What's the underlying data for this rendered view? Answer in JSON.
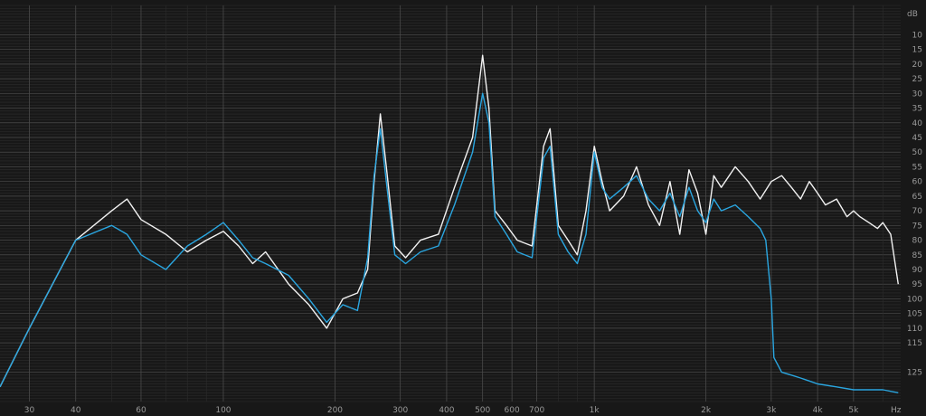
{
  "app": {
    "kind": "spectrum-analyzer"
  },
  "colors": {
    "background": "#151515",
    "plot_background": "#181818",
    "grid_major": "#4a4a4a",
    "grid_minor": "#2c2c2c",
    "tick_text": "#9a9a9a",
    "series_white": "#f2f2f2",
    "series_blue": "#2aa6e0"
  },
  "chart_data": {
    "type": "line",
    "x_scale": "log",
    "xlim": [
      25,
      6700
    ],
    "ylim": [
      0,
      135
    ],
    "y_inverted": true,
    "grid": true,
    "x_ticks": [
      {
        "value": 30,
        "label": "30"
      },
      {
        "value": 40,
        "label": "40"
      },
      {
        "value": 60,
        "label": "60"
      },
      {
        "value": 100,
        "label": "100"
      },
      {
        "value": 200,
        "label": "200"
      },
      {
        "value": 300,
        "label": "300"
      },
      {
        "value": 400,
        "label": "400"
      },
      {
        "value": 500,
        "label": "500"
      },
      {
        "value": 600,
        "label": "600"
      },
      {
        "value": 700,
        "label": "700"
      },
      {
        "value": 1000,
        "label": "1k"
      },
      {
        "value": 2000,
        "label": "2k"
      },
      {
        "value": 3000,
        "label": "3k"
      },
      {
        "value": 4000,
        "label": "4k"
      },
      {
        "value": 5000,
        "label": "5k"
      }
    ],
    "x_unit_label": "Hz",
    "y_ticks": [
      10,
      15,
      20,
      25,
      30,
      35,
      40,
      45,
      50,
      55,
      60,
      65,
      70,
      75,
      80,
      85,
      90,
      95,
      100,
      105,
      110,
      115,
      125
    ],
    "y_unit_label": "dB",
    "series": [
      {
        "key": "white",
        "color": "#f2f2f2",
        "x": [
          25,
          30,
          40,
          50,
          55,
          60,
          70,
          80,
          90,
          100,
          110,
          120,
          130,
          150,
          170,
          190,
          210,
          230,
          245,
          255,
          265,
          275,
          290,
          310,
          340,
          380,
          420,
          470,
          500,
          520,
          540,
          580,
          620,
          680,
          730,
          760,
          800,
          850,
          900,
          950,
          1000,
          1050,
          1100,
          1200,
          1300,
          1400,
          1500,
          1600,
          1700,
          1800,
          1900,
          2000,
          2100,
          2200,
          2400,
          2600,
          2800,
          3000,
          3200,
          3400,
          3600,
          3800,
          4000,
          4200,
          4500,
          4800,
          5000,
          5200,
          5500,
          5800,
          6000,
          6300,
          6600
        ],
        "y": [
          130,
          110,
          80,
          70,
          66,
          73,
          78,
          84,
          80,
          77,
          82,
          88,
          84,
          95,
          102,
          110,
          100,
          98,
          90,
          60,
          37,
          55,
          82,
          86,
          80,
          78,
          62,
          45,
          17,
          35,
          70,
          75,
          80,
          82,
          48,
          42,
          75,
          80,
          85,
          70,
          48,
          60,
          70,
          65,
          55,
          68,
          75,
          60,
          78,
          56,
          64,
          78,
          58,
          62,
          55,
          60,
          66,
          60,
          58,
          62,
          66,
          60,
          64,
          68,
          66,
          72,
          70,
          72,
          74,
          76,
          74,
          78,
          95
        ]
      },
      {
        "key": "blue",
        "color": "#2aa6e0",
        "x": [
          25,
          30,
          40,
          50,
          55,
          60,
          70,
          80,
          90,
          100,
          110,
          120,
          130,
          150,
          170,
          190,
          210,
          230,
          245,
          255,
          265,
          275,
          290,
          310,
          340,
          380,
          420,
          470,
          500,
          520,
          540,
          580,
          620,
          680,
          730,
          760,
          800,
          850,
          900,
          950,
          1000,
          1050,
          1100,
          1200,
          1300,
          1400,
          1500,
          1600,
          1700,
          1800,
          1900,
          2000,
          2100,
          2200,
          2400,
          2600,
          2800,
          2900,
          3000,
          3050,
          3200,
          3400,
          3600,
          3800,
          4000,
          4500,
          5000,
          5500,
          6000,
          6600
        ],
        "y": [
          130,
          110,
          80,
          75,
          78,
          85,
          90,
          82,
          78,
          74,
          80,
          86,
          88,
          92,
          100,
          108,
          102,
          104,
          86,
          58,
          42,
          60,
          85,
          88,
          84,
          82,
          68,
          50,
          30,
          40,
          72,
          78,
          84,
          86,
          52,
          48,
          78,
          84,
          88,
          78,
          50,
          62,
          66,
          62,
          58,
          66,
          70,
          64,
          72,
          62,
          70,
          74,
          66,
          70,
          68,
          72,
          76,
          80,
          100,
          120,
          125,
          126,
          127,
          128,
          129,
          130,
          131,
          131,
          131,
          132
        ]
      }
    ]
  }
}
